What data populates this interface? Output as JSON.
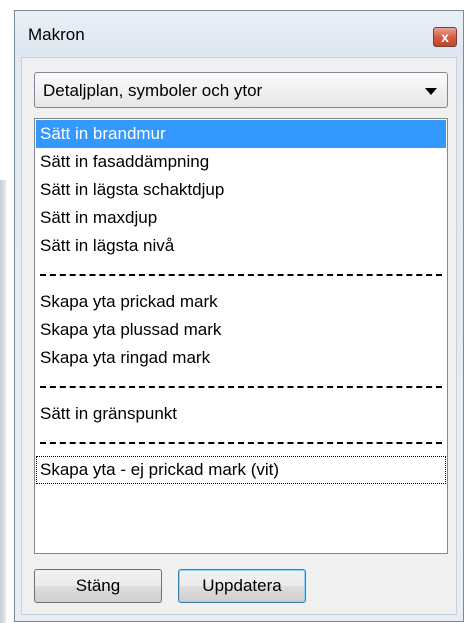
{
  "window": {
    "title": "Makron",
    "close_glyph": "x"
  },
  "dropdown": {
    "selected": "Detaljplan, symboler och ytor"
  },
  "list": {
    "items": [
      {
        "type": "item",
        "label": "Sätt in brandmur",
        "selected": true
      },
      {
        "type": "item",
        "label": "Sätt in fasaddämpning"
      },
      {
        "type": "item",
        "label": "Sätt in lägsta schaktdjup"
      },
      {
        "type": "item",
        "label": "Sätt in maxdjup"
      },
      {
        "type": "item",
        "label": "Sätt in lägsta nivå"
      },
      {
        "type": "separator"
      },
      {
        "type": "item",
        "label": "Skapa yta prickad mark"
      },
      {
        "type": "item",
        "label": "Skapa yta plussad mark"
      },
      {
        "type": "item",
        "label": "Skapa yta ringad mark"
      },
      {
        "type": "separator"
      },
      {
        "type": "item",
        "label": "Sätt in gränspunkt"
      },
      {
        "type": "separator"
      },
      {
        "type": "item",
        "label": "Skapa yta - ej prickad mark (vit)",
        "focused": true
      }
    ]
  },
  "buttons": {
    "close_label": "Stäng",
    "update_label": "Uppdatera"
  },
  "colors": {
    "selection": "#3399ff",
    "close_button": "#c94a33"
  }
}
